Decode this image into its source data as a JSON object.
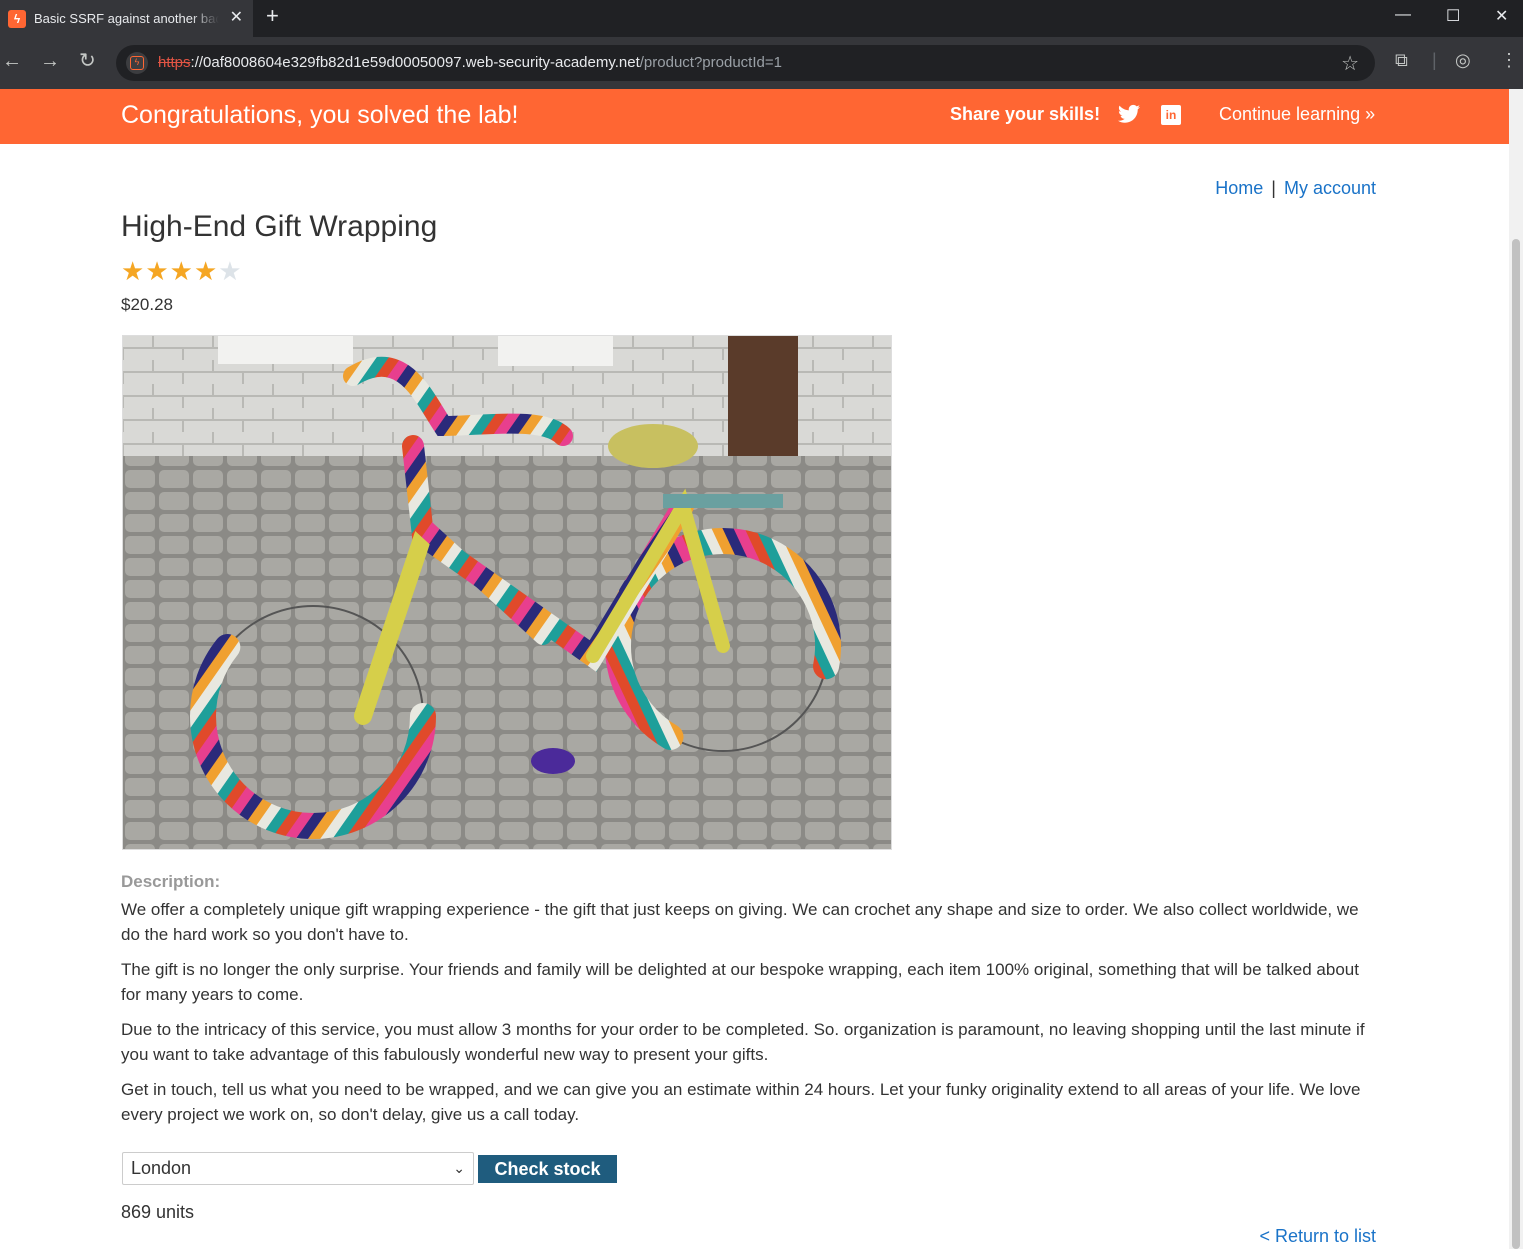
{
  "browser": {
    "tab_title": "Basic SSRF against another back-end system",
    "new_tab": "+",
    "url_scheme": "https",
    "url_host": "://0af8008604e329fb82d1e59d00050097.web-security-academy.net",
    "url_path": "/product?productId=1"
  },
  "banner": {
    "message": "Congratulations, you solved the lab!",
    "share": "Share your skills!",
    "continue": "Continue learning"
  },
  "nav": {
    "home": "Home",
    "separator": "|",
    "account": "My account"
  },
  "product": {
    "title": "High-End Gift Wrapping",
    "rating": 4,
    "rating_max": 5,
    "price": "$20.28",
    "image_alt": "Bicycle covered in colorful crochet"
  },
  "description": {
    "label": "Description:",
    "paragraphs": [
      "We offer a completely unique gift wrapping experience - the gift that just keeps on giving. We can crochet any shape and size to order. We also collect worldwide, we do the hard work so you don't have to.",
      "The gift is no longer the only surprise. Your friends and family will be delighted at our bespoke wrapping, each item 100% original, something that will be talked about for many years to come.",
      "Due to the intricacy of this service, you must allow 3 months for your order to be completed. So. organization is paramount, no leaving shopping until the last minute if you want to take advantage of this fabulously wonderful new way to present your gifts.",
      "Get in touch, tell us what you need to be wrapped, and we can give you an estimate within 24 hours. Let your funky originality extend to all areas of your life. We love every project we work on, so don't delay, give us a call today."
    ]
  },
  "stock": {
    "selected_store": "London",
    "button": "Check stock",
    "result": "869 units"
  },
  "footer": {
    "return": "< Return to list"
  },
  "colors": {
    "banner": "#ff6633",
    "link": "#1a73c8",
    "button": "#1f5c7e",
    "star": "#f5a623"
  }
}
